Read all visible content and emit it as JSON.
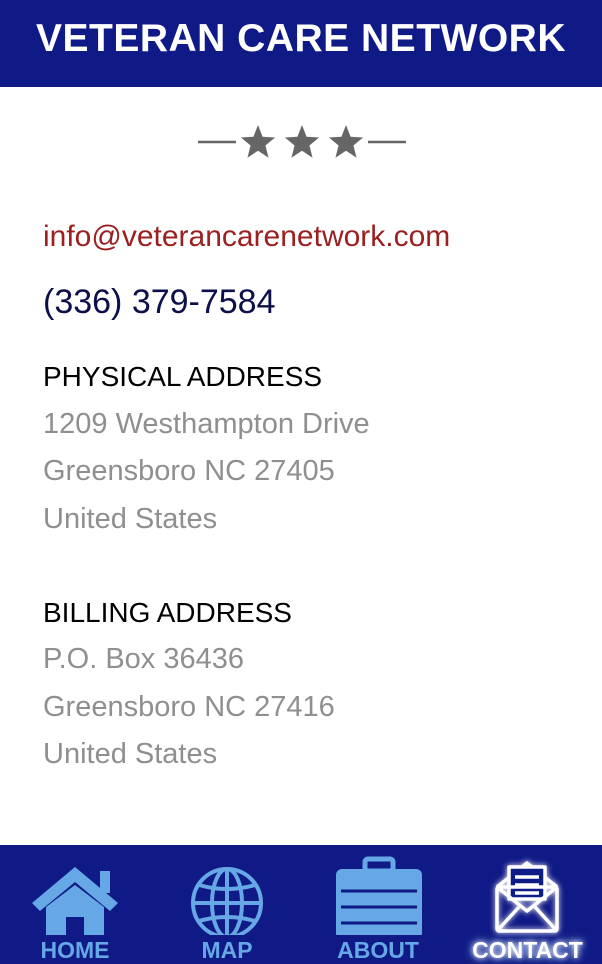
{
  "header": {
    "title": "VETERAN CARE NETWORK"
  },
  "contact": {
    "email": "info@veterancarenetwork.com",
    "phone": "(336) 379-7584"
  },
  "physical_address": {
    "title": "PHYSICAL ADDRESS",
    "lines": [
      "1209 Westhampton Drive",
      "Greensboro NC 27405",
      "United States"
    ]
  },
  "billing_address": {
    "title": "BILLING ADDRESS",
    "lines": [
      "P.O. Box 36436",
      "Greensboro NC 27416",
      "United States"
    ]
  },
  "nav": {
    "items": [
      {
        "label": "HOME",
        "icon": "home-icon"
      },
      {
        "label": "MAP",
        "icon": "globe-icon"
      },
      {
        "label": "ABOUT",
        "icon": "briefcase-icon"
      },
      {
        "label": "CONTACT",
        "icon": "envelope-icon",
        "active": true
      }
    ]
  },
  "colors": {
    "brand_navy": "#101a86",
    "email_red": "#9c2020",
    "phone_navy": "#0d0f4a",
    "address_gray": "#8f8f8f",
    "nav_icon_blue": "#66a8e6"
  }
}
